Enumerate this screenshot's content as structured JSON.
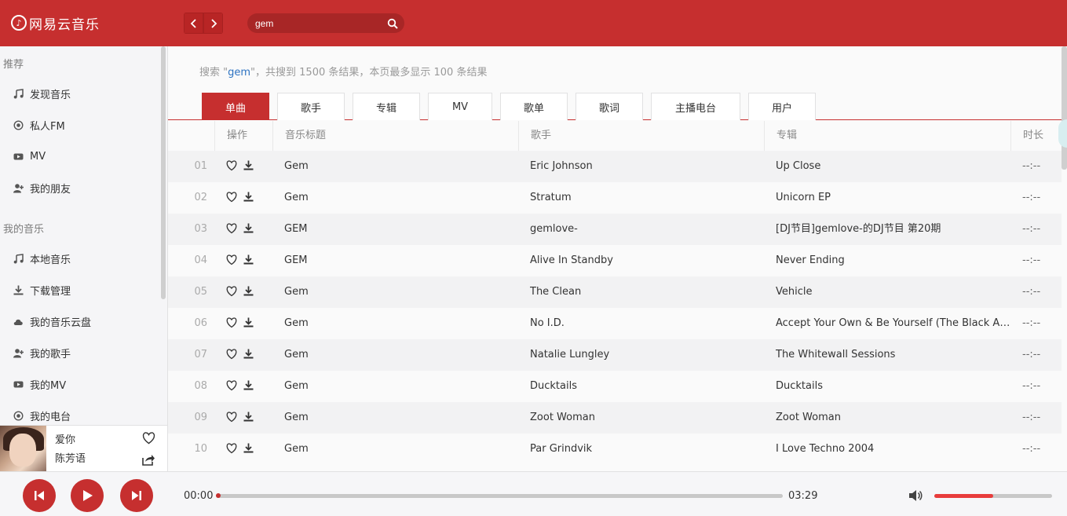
{
  "app": {
    "title": "网易云音乐",
    "logo_glyph": "♪"
  },
  "search": {
    "value": "gem"
  },
  "sidebar": {
    "sections": [
      {
        "heading": "推荐",
        "items": [
          {
            "label": "发现音乐",
            "icon": "music-note-icon"
          },
          {
            "label": "私人FM",
            "icon": "radio-icon"
          },
          {
            "label": "MV",
            "icon": "video-icon"
          },
          {
            "label": "我的朋友",
            "icon": "add-friend-icon"
          }
        ]
      },
      {
        "heading": "我的音乐",
        "items": [
          {
            "label": "本地音乐",
            "icon": "music-note-icon"
          },
          {
            "label": "下载管理",
            "icon": "download-icon"
          },
          {
            "label": "我的音乐云盘",
            "icon": "cloud-icon"
          },
          {
            "label": "我的歌手",
            "icon": "add-friend-icon"
          },
          {
            "label": "我的MV",
            "icon": "video-icon"
          },
          {
            "label": "我的电台",
            "icon": "radio-icon"
          }
        ]
      }
    ]
  },
  "now_playing": {
    "title": "爱你",
    "artist": "陈芳语"
  },
  "results": {
    "summary_prefix": "搜索 \"",
    "keyword": "gem",
    "summary_suffix": "\"，共搜到 1500 条结果，本页最多显示 100 条结果",
    "tabs": [
      "单曲",
      "歌手",
      "专辑",
      "MV",
      "歌单",
      "歌词",
      "主播电台",
      "用户"
    ],
    "active_tab": 0,
    "columns": [
      "操作",
      "音乐标题",
      "歌手",
      "专辑",
      "时长"
    ],
    "rows": [
      {
        "num": "01",
        "title": "Gem",
        "artist": "Eric Johnson",
        "album": "Up Close",
        "duration": "--:--"
      },
      {
        "num": "02",
        "title": "Gem",
        "artist": "Stratum",
        "album": "Unicorn EP",
        "duration": "--:--"
      },
      {
        "num": "03",
        "title": "GEM",
        "artist": "gemlove-",
        "album": "[DJ节目]gemlove-的DJ节目 第20期",
        "duration": "--:--"
      },
      {
        "num": "04",
        "title": "GEM",
        "artist": "Alive In Standby",
        "album": "Never Ending",
        "duration": "--:--"
      },
      {
        "num": "05",
        "title": "Gem",
        "artist": "The Clean",
        "album": "Vehicle",
        "duration": "--:--"
      },
      {
        "num": "06",
        "title": "Gem",
        "artist": "No I.D.",
        "album": "Accept Your Own & Be Yourself (The Black Al...",
        "duration": "--:--"
      },
      {
        "num": "07",
        "title": "Gem",
        "artist": "Natalie Lungley",
        "album": "The Whitewall Sessions",
        "duration": "--:--"
      },
      {
        "num": "08",
        "title": "Gem",
        "artist": "Ducktails",
        "album": "Ducktails",
        "duration": "--:--"
      },
      {
        "num": "09",
        "title": "Gem",
        "artist": "Zoot Woman",
        "album": "Zoot Woman",
        "duration": "--:--"
      },
      {
        "num": "10",
        "title": "Gem",
        "artist": "Par Grindvik",
        "album": "I Love Techno 2004",
        "duration": "--:--"
      }
    ]
  },
  "player": {
    "current_time": "00:00",
    "total_time": "03:29",
    "progress": 0.0,
    "volume": 0.5
  },
  "colors": {
    "brand": "#c62f2f",
    "accent_link": "#2d73c2"
  }
}
